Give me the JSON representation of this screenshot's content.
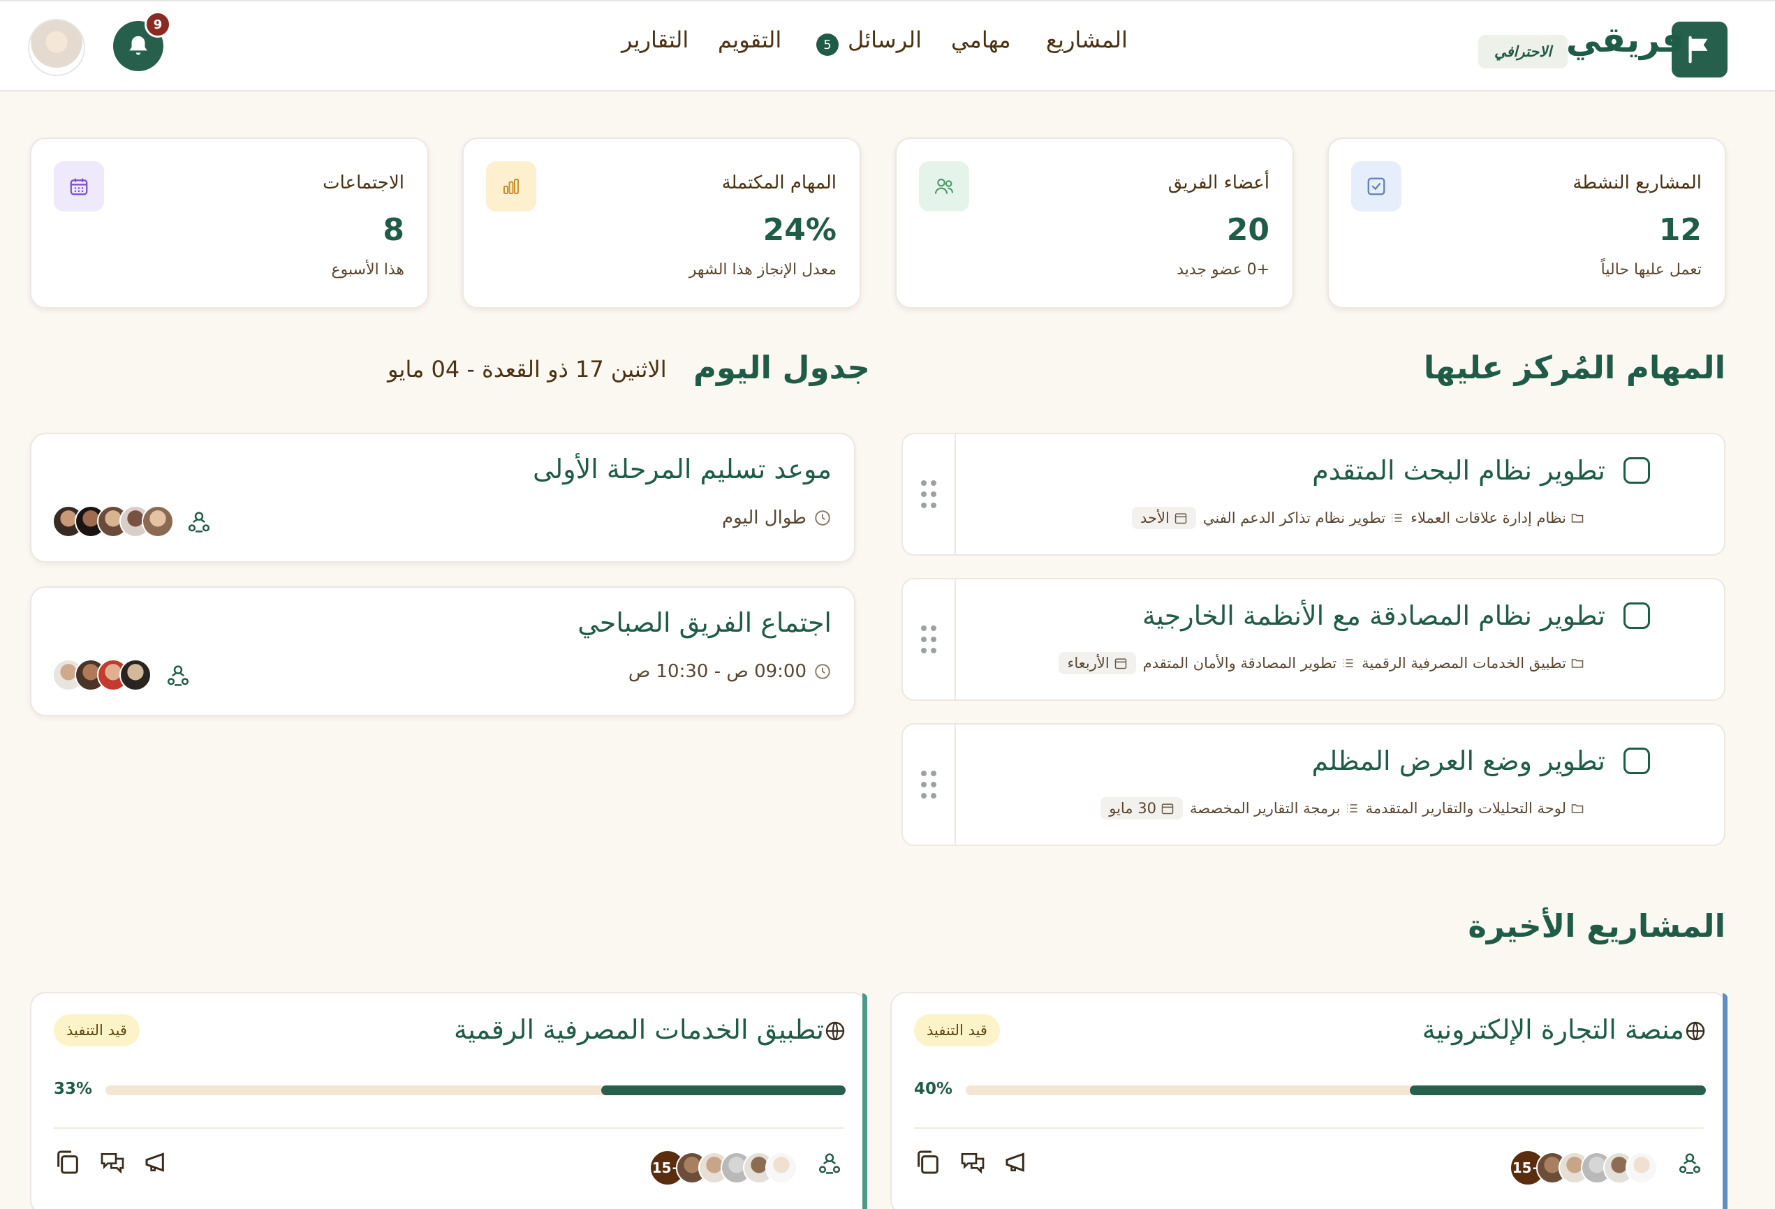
{
  "header": {
    "brand": "فريقي",
    "badge": "الاحترافي",
    "nav": [
      {
        "label": "المشاريع"
      },
      {
        "label": "مهامي"
      },
      {
        "label": "الرسائل",
        "count": "5"
      },
      {
        "label": "التقويم"
      },
      {
        "label": "التقارير"
      }
    ],
    "notifications_count": "9"
  },
  "stats": [
    {
      "title": "المشاريع النشطة",
      "value": "12",
      "sub": "تعمل عليها حالياً",
      "icon": "checkbox-icon",
      "color": "#e6eefb"
    },
    {
      "title": "أعضاء الفريق",
      "value": "20",
      "sub": "+0 عضو جديد",
      "icon": "users-icon",
      "color": "#e4f4ea"
    },
    {
      "title": "المهام المكتملة",
      "value": "24%",
      "sub": "معدل الإنجاز هذا الشهر",
      "icon": "bar-chart-icon",
      "color": "#fdf0cf"
    },
    {
      "title": "الاجتماعات",
      "value": "8",
      "sub": "هذا الأسبوع",
      "icon": "calendar-icon",
      "color": "#eee9fb"
    }
  ],
  "focus": {
    "title": "المهام المُركز عليها",
    "tasks": [
      {
        "title": "تطوير نظام البحث المتقدم",
        "project": "نظام إدارة علاقات العملاء",
        "list": "تطوير نظام تذاكر الدعم الفني",
        "due": "الأحد"
      },
      {
        "title": "تطوير نظام المصادقة مع الأنظمة الخارجية",
        "project": "تطبيق الخدمات المصرفية الرقمية",
        "list": "تطوير المصادقة والأمان المتقدم",
        "due": "الأربعاء"
      },
      {
        "title": "تطوير وضع العرض المظلم",
        "project": "لوحة التحليلات والتقارير المتقدمة",
        "list": "برمجة التقارير المخصصة",
        "due": "30 مايو"
      }
    ]
  },
  "schedule": {
    "title": "جدول اليوم",
    "date": "الاثنين 17 ذو القعدة - 04 مايو",
    "events": [
      {
        "title": "موعد تسليم المرحلة الأولى",
        "time": "طوال اليوم"
      },
      {
        "title": "اجتماع الفريق الصباحي",
        "time": "09:00 ص  -  10:30 ص"
      }
    ]
  },
  "projects": {
    "title": "المشاريع الأخيرة",
    "items": [
      {
        "title": "منصة التجارة الإلكترونية",
        "status": "قيد التنفيذ",
        "progress_label": "40%",
        "progress": 0.4,
        "members_more": "15+",
        "accent": "#5b8fc7"
      },
      {
        "title": "تطبيق الخدمات المصرفية الرقمية",
        "status": "قيد التنفيذ",
        "progress_label": "33%",
        "progress": 0.33,
        "members_more": "15+",
        "accent": "#4a9a8a"
      }
    ]
  }
}
